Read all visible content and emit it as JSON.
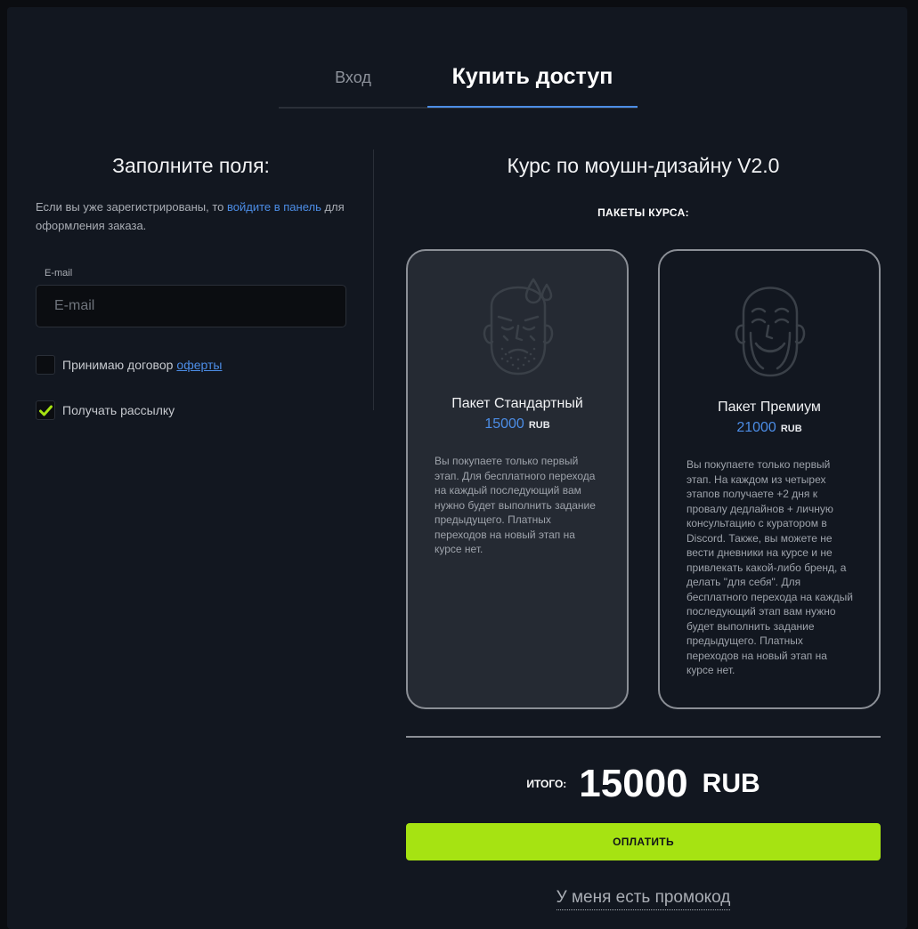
{
  "tabs": {
    "login": "Вход",
    "buy": "Купить доступ"
  },
  "form": {
    "title": "Заполните поля:",
    "note_before": "Если вы уже зарегистрированы, то ",
    "note_link": "войдите в панель",
    "note_after": " для оформления заказа.",
    "email_label": "E-mail",
    "email_placeholder": "E-mail",
    "email_value": "",
    "offer_text": "Принимаю договор",
    "offer_link": "оферты",
    "offer_checked": false,
    "newsletter_text": "Получать рассылку",
    "newsletter_checked": true
  },
  "course": {
    "title": "Курс по моушн-дизайну V2.0",
    "packages_label": "ПАКЕТЫ КУРСА:",
    "packages": [
      {
        "name": "Пакет Стандартный",
        "price": "15000",
        "currency": "RUB",
        "selected": true,
        "icon": "sweating-face-icon",
        "description": "Вы покупаете только первый этап. Для бесплатного перехода на каждый последующий вам нужно будет выполнить задание предыдущего. Платных переходов на новый этап на курсе нет."
      },
      {
        "name": "Пакет Премиум",
        "price": "21000",
        "currency": "RUB",
        "selected": false,
        "icon": "happy-old-face-icon",
        "description": "Вы покупаете только первый этап. На каждом из четырех этапов получаете +2 дня к провалу дедлайнов + личную консультацию с куратором в Discord. Также, вы можете не вести дневники на курсе и не привлекать какой-либо бренд, а делать \"для себя\". Для бесплатного перехода на каждый последующий этап вам нужно будет выполнить задание предыдущего. Платных переходов на новый этап на курсе нет."
      }
    ]
  },
  "total": {
    "label": "ИТОГО:",
    "amount": "15000",
    "currency": "RUB"
  },
  "pay_button": "ОПЛАТИТЬ",
  "promo_link": "У меня есть промокод",
  "colors": {
    "accent": "#4c8de6",
    "pay": "#a6e312",
    "check": "#a6e312",
    "panel": "#121720",
    "background": "#0b0d11"
  }
}
